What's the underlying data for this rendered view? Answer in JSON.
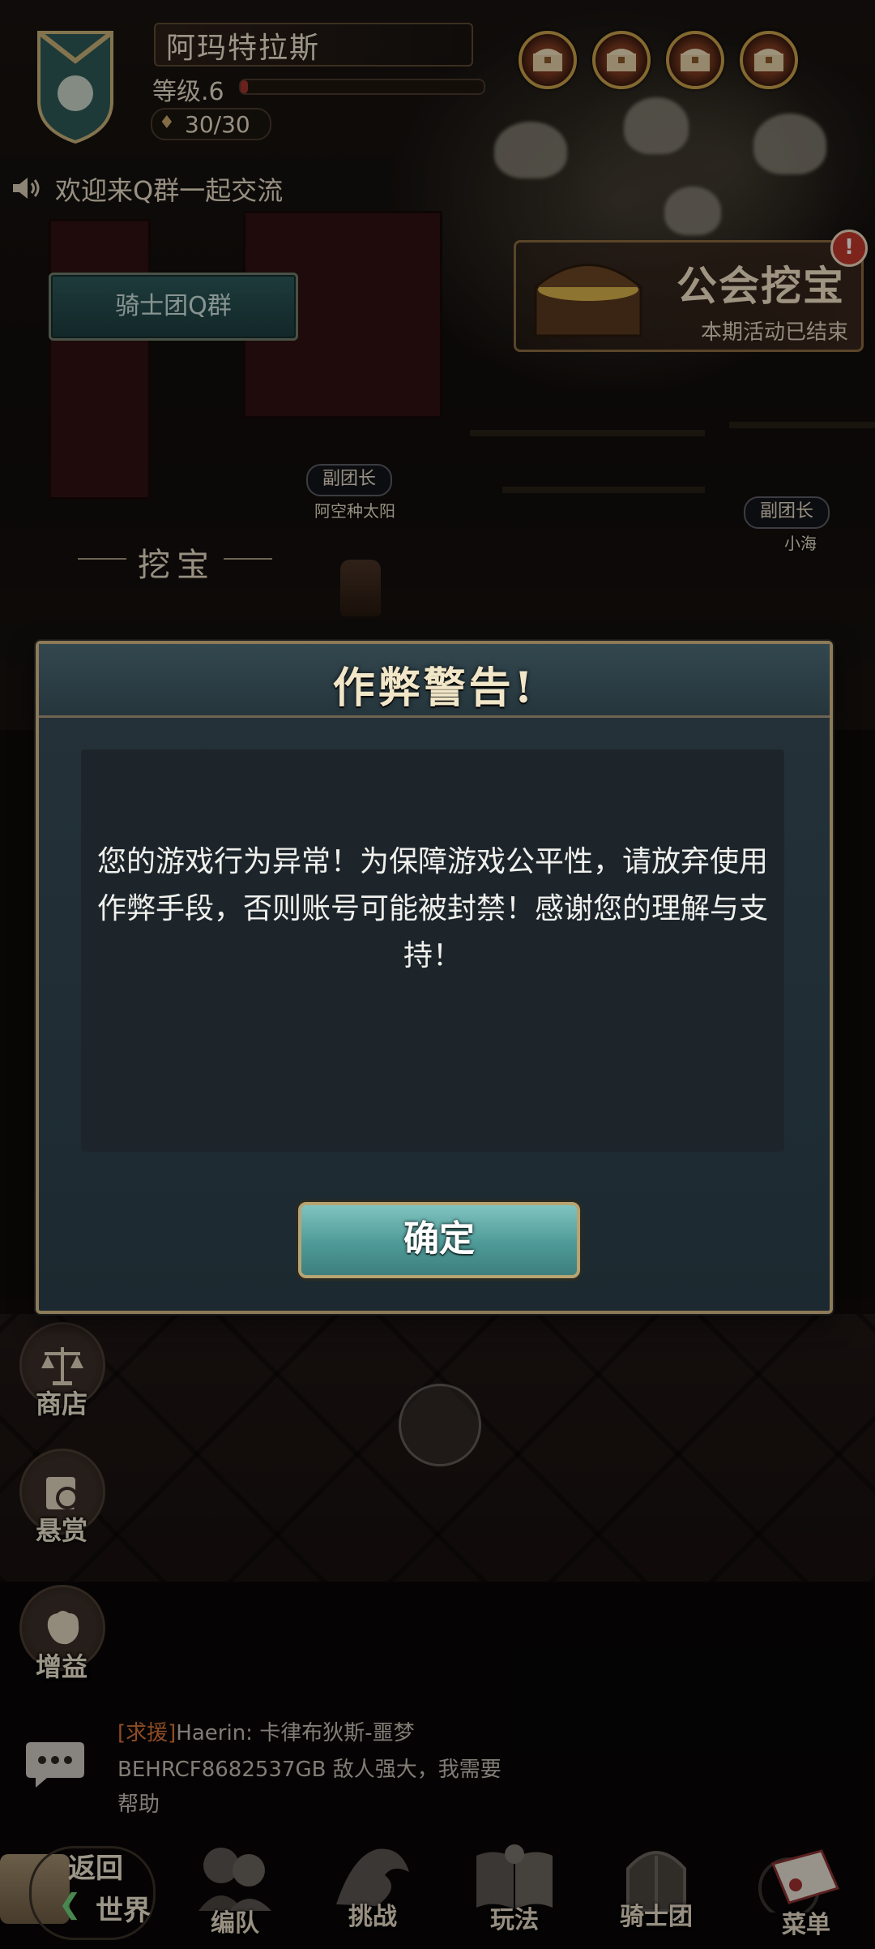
{
  "header": {
    "player_name": "阿玛特拉斯",
    "level": "等级.6",
    "xp_fraction": 0.03,
    "stamina": "30/30",
    "chest_count": 4
  },
  "announcement": "欢迎来Q群一起交流",
  "qq_group_button": "骑士团Q群",
  "guild_dig": {
    "title": "公会挖宝",
    "subtitle": "本期活动已结束",
    "alert": "!"
  },
  "npcs": [
    {
      "role": "副团长",
      "name": "阿空种太阳"
    },
    {
      "role": "副团长",
      "name": "小海"
    }
  ],
  "dig_label": "挖宝",
  "side_buttons": [
    {
      "label": "商店",
      "icon": "scales-icon"
    },
    {
      "label": "悬赏",
      "icon": "scroll-icon"
    },
    {
      "label": "增益",
      "icon": "fist-icon"
    }
  ],
  "chat": {
    "tag": "[求援]",
    "line1_rest": "Haerin: 卡律布狄斯-噩梦",
    "line2": "BEHRCF8682537GB 敌人强大，我需要",
    "line3": "帮助"
  },
  "bottom_nav": {
    "back_line1": "返回",
    "back_line2": "世界",
    "items": [
      {
        "label": "编队",
        "icon": "team-icon"
      },
      {
        "label": "挑战",
        "icon": "dragon-icon"
      },
      {
        "label": "玩法",
        "icon": "book-icon"
      },
      {
        "label": "骑士团",
        "icon": "castle-gate-icon"
      },
      {
        "label": "菜单",
        "icon": "menu-book-icon"
      }
    ]
  },
  "modal": {
    "title": "作弊警告!",
    "message": "您的游戏行为异常！为保障游戏公平性，请放弃使用作弊手段，否则账号可能被封禁！感谢您的理解与支持！",
    "ok_label": "确定"
  },
  "colors": {
    "modal_bg": "#1c2930",
    "ok_button": "#5aa8a6",
    "frame_gold": "#8c7a58",
    "chat_tag": "#d9763a"
  }
}
